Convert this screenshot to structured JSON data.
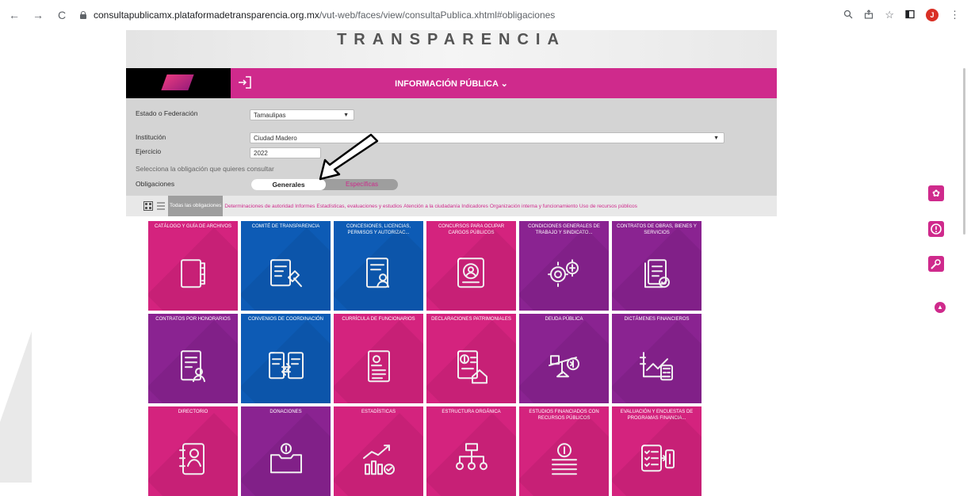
{
  "browser": {
    "nav": {
      "back": "←",
      "forward": "→",
      "reload": "C"
    },
    "url_host": "consultapublicamx.plataformadetransparencia.org.mx",
    "url_path": "/vut-web/faces/view/consultaPublica.xhtml#obligaciones",
    "avatar_letter": "J"
  },
  "banner": {
    "title": "TRANSPARENCIA"
  },
  "infobar": {
    "title": "INFORMACIÓN PÚBLICA ⌄"
  },
  "filters": {
    "estado_label": "Estado o Federación",
    "estado_value": "Tamaulipas",
    "institucion_label": "Institución",
    "institucion_value": "Ciudad Madero",
    "ejercicio_label": "Ejercicio",
    "ejercicio_value": "2022",
    "hint": "Selecciona la obligación que quieres consultar",
    "obligaciones_label": "Obligaciones",
    "toggle_generales": "Generales",
    "toggle_especificas": "Específicas"
  },
  "tabs": {
    "all": "Todas las obligaciones",
    "items": [
      "Determinaciones de autoridad",
      "Informes",
      "Estadísticas, evaluaciones y estudios",
      "Atención a la ciudadanía",
      "Indicadores",
      "Organización interna y funcionamiento",
      "Uso de recursos públicos"
    ]
  },
  "tiles": [
    {
      "label": "CATÁLOGO Y GUÍA DE ARCHIVOS",
      "color": "#d4237e",
      "icon": "binder-icon"
    },
    {
      "label": "COMITÉ DE TRANSPARENCIA",
      "color": "#0d5bb5",
      "icon": "document-gavel-icon"
    },
    {
      "label": "CONCESIONES, LICENCIAS, PERMISOS Y AUTORIZAC...",
      "color": "#0d5bb5",
      "icon": "document-person-icon"
    },
    {
      "label": "CONCURSOS PARA OCUPAR CARGOS PÚBLICOS",
      "color": "#d4237e",
      "icon": "search-person-icon"
    },
    {
      "label": "CONDICIONES GENERALES DE TRABAJO Y SINDICATO...",
      "color": "#8a2391",
      "icon": "gears-icon"
    },
    {
      "label": "CONTRATOS DE OBRAS, BIENES Y SERVICIOS",
      "color": "#8a2391",
      "icon": "contracts-icon"
    },
    {
      "label": "CONTRATOS POR HONORARIOS",
      "color": "#8a2391",
      "icon": "document-user-icon"
    },
    {
      "label": "CONVENIOS DE COORDINACIÓN",
      "color": "#0d5bb5",
      "icon": "exchange-documents-icon"
    },
    {
      "label": "CURRÍCULA DE FUNCIONARIOS",
      "color": "#d4237e",
      "icon": "resume-icon"
    },
    {
      "label": "DECLARACIONES PATRIMONIALES",
      "color": "#d4237e",
      "icon": "declaration-house-icon"
    },
    {
      "label": "DEUDA PÚBLICA",
      "color": "#8a2391",
      "icon": "balance-scale-icon"
    },
    {
      "label": "DICTÁMENES FINANCIEROS",
      "color": "#8a2391",
      "icon": "financial-chart-icon"
    },
    {
      "label": "DIRECTORIO",
      "color": "#d4237e",
      "icon": "directory-icon"
    },
    {
      "label": "DONACIONES",
      "color": "#8a2391",
      "icon": "donation-box-icon"
    },
    {
      "label": "ESTADÍSTICAS",
      "color": "#d4237e",
      "icon": "statistics-icon"
    },
    {
      "label": "ESTRUCTURA ORGÁNICA",
      "color": "#d4237e",
      "icon": "org-chart-icon"
    },
    {
      "label": "ESTUDIOS FINANCIADOS CON RECURSOS PÚBLICOS",
      "color": "#d4237e",
      "icon": "coins-stack-icon"
    },
    {
      "label": "EVALUACIÓN Y ENCUESTAS DE PROGRAMAS FINANCIA...",
      "color": "#d4237e",
      "icon": "checklist-money-icon"
    }
  ]
}
